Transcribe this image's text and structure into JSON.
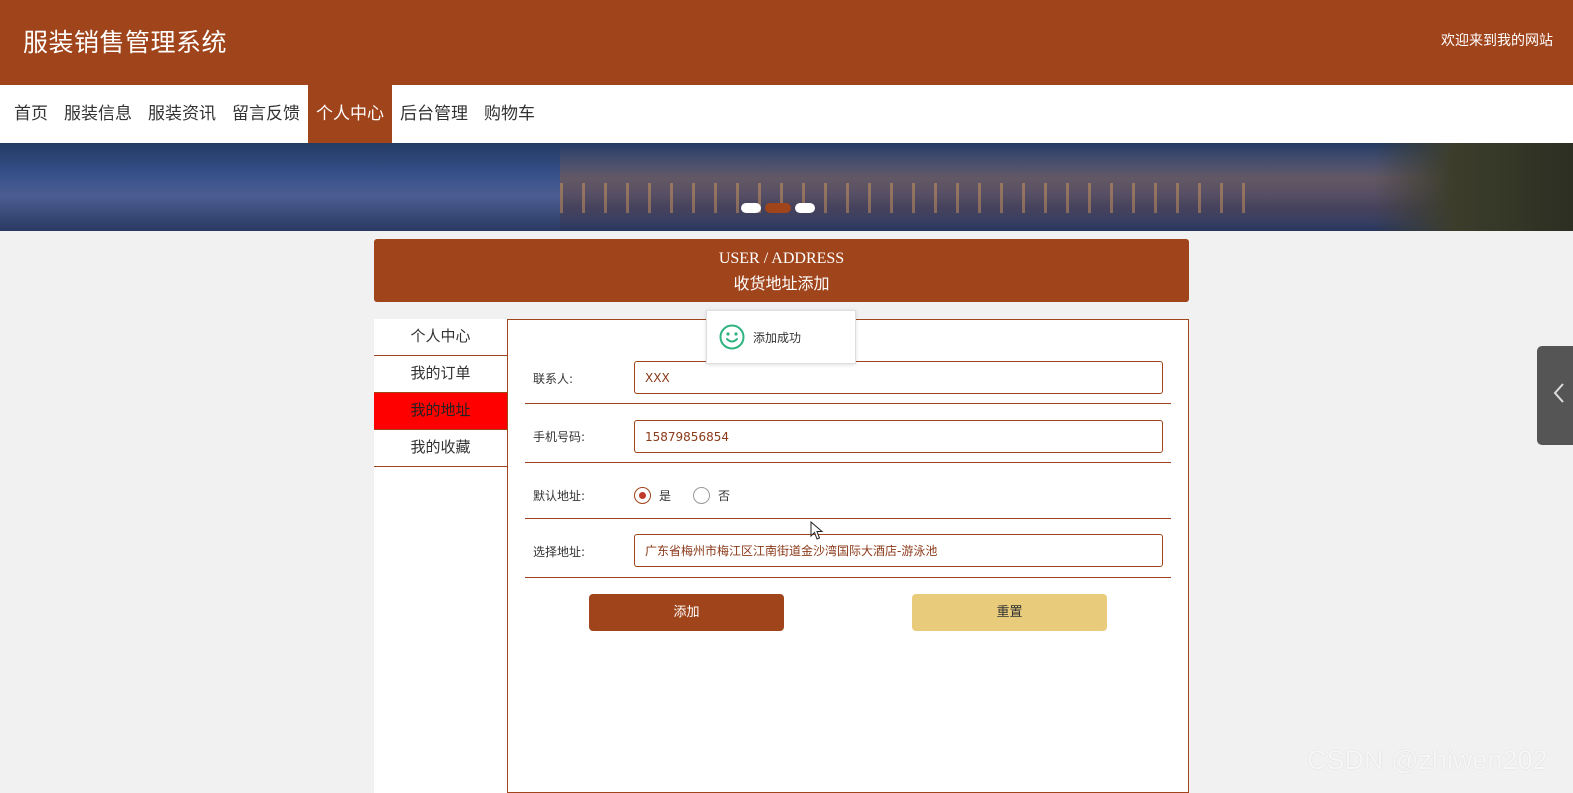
{
  "header": {
    "site_title": "服装销售管理系统",
    "welcome": "欢迎来到我的网站"
  },
  "nav": {
    "items": [
      "首页",
      "服装信息",
      "服装资讯",
      "留言反馈",
      "个人中心",
      "后台管理",
      "购物车"
    ],
    "active_index": 4
  },
  "banner": {
    "slide_count": 3,
    "active_slide": 1
  },
  "section": {
    "title_en": "USER / ADDRESS",
    "title_cn": "收货地址添加"
  },
  "sidebar": {
    "items": [
      "个人中心",
      "我的订单",
      "我的地址",
      "我的收藏"
    ],
    "active_index": 2
  },
  "form": {
    "contact_label": "联系人:",
    "contact_value": "XXX",
    "phone_label": "手机号码:",
    "phone_value": "15879856854",
    "default_label": "默认地址:",
    "default_options": [
      "是",
      "否"
    ],
    "default_selected": "是",
    "address_label": "选择地址:",
    "address_value": "广东省梅州市梅江区江南街道金沙湾国际大酒店-游泳池",
    "add_button": "添加",
    "reset_button": "重置"
  },
  "toast": {
    "text": "添加成功",
    "icon": "smile-icon"
  },
  "watermark": "CSDN @zhiwen202",
  "colors": {
    "brand": "#a0441b",
    "active_side": "#ff0000",
    "reset_button": "#e8cc7c",
    "background": "#f1f1f1"
  }
}
